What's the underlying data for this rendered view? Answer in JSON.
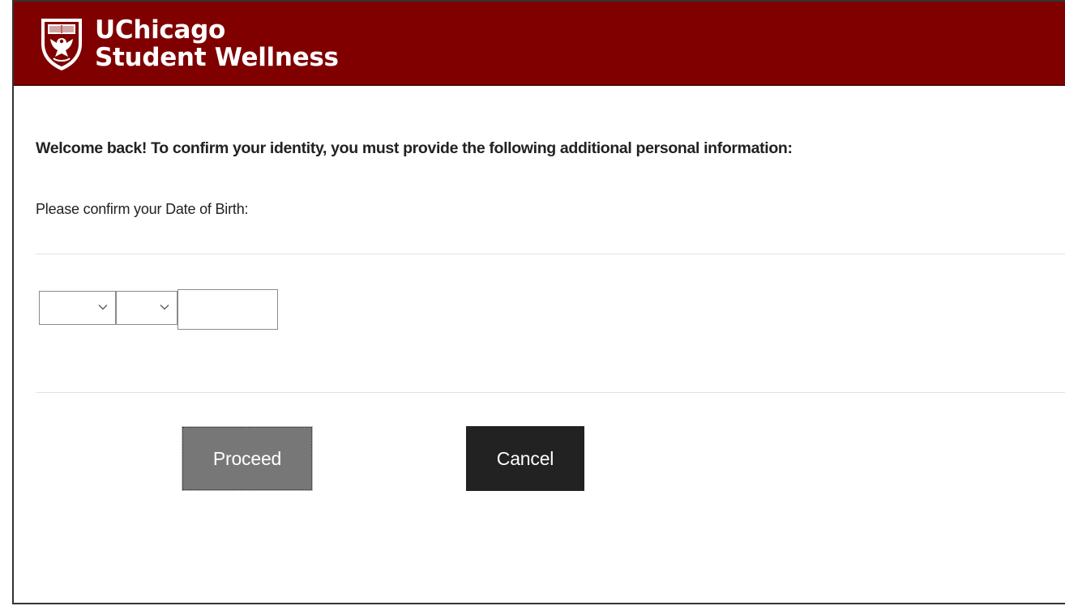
{
  "header": {
    "brand_line1": "UChicago",
    "brand_line2": "Student Wellness",
    "logo_icon": "uchicago-phoenix-shield-icon",
    "background_color": "#800000"
  },
  "form": {
    "welcome_message": "Welcome back! To confirm your identity, you must provide the following additional personal information:",
    "dob_prompt": "Please confirm your Date of Birth:",
    "month_value": "",
    "day_value": "",
    "year_value": "",
    "dropdown_icon": "chevron-down-icon"
  },
  "actions": {
    "proceed_label": "Proceed",
    "cancel_label": "Cancel",
    "proceed_color": "#777777",
    "cancel_color": "#222222"
  }
}
